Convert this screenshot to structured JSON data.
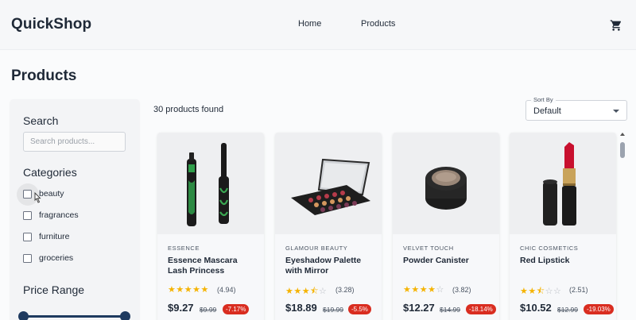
{
  "header": {
    "brand": "QuickShop",
    "nav": [
      "Home",
      "Products"
    ],
    "cart_icon": "cart-icon"
  },
  "page": {
    "title": "Products"
  },
  "sidebar": {
    "search_heading": "Search",
    "search_placeholder": "Search products...",
    "categories_heading": "Categories",
    "categories": [
      {
        "label": "beauty",
        "checked": false
      },
      {
        "label": "fragrances",
        "checked": false
      },
      {
        "label": "furniture",
        "checked": false
      },
      {
        "label": "groceries",
        "checked": false
      }
    ],
    "price_heading": "Price Range"
  },
  "results": {
    "count_text": "30 products found",
    "sort_label": "Sort By",
    "sort_value": "Default"
  },
  "products": [
    {
      "brand": "ESSENCE",
      "name": "Essence Mascara Lash Princess",
      "rating": "(4.94)",
      "price": "$9.27",
      "old_price": "$9.99",
      "discount": "-7.17%"
    },
    {
      "brand": "GLAMOUR BEAUTY",
      "name": "Eyeshadow Palette with Mirror",
      "rating": "(3.28)",
      "price": "$18.89",
      "old_price": "$19.99",
      "discount": "-5.5%"
    },
    {
      "brand": "VELVET TOUCH",
      "name": "Powder Canister",
      "rating": "(3.82)",
      "price": "$12.27",
      "old_price": "$14.99",
      "discount": "-18.14%"
    },
    {
      "brand": "CHIC COSMETICS",
      "name": "Red Lipstick",
      "rating": "(2.51)",
      "price": "$10.52",
      "old_price": "$12.99",
      "discount": "-19.03%"
    }
  ],
  "colors": {
    "accent": "#1e3a5f",
    "star": "#f5b301",
    "discount": "#d92d20"
  }
}
